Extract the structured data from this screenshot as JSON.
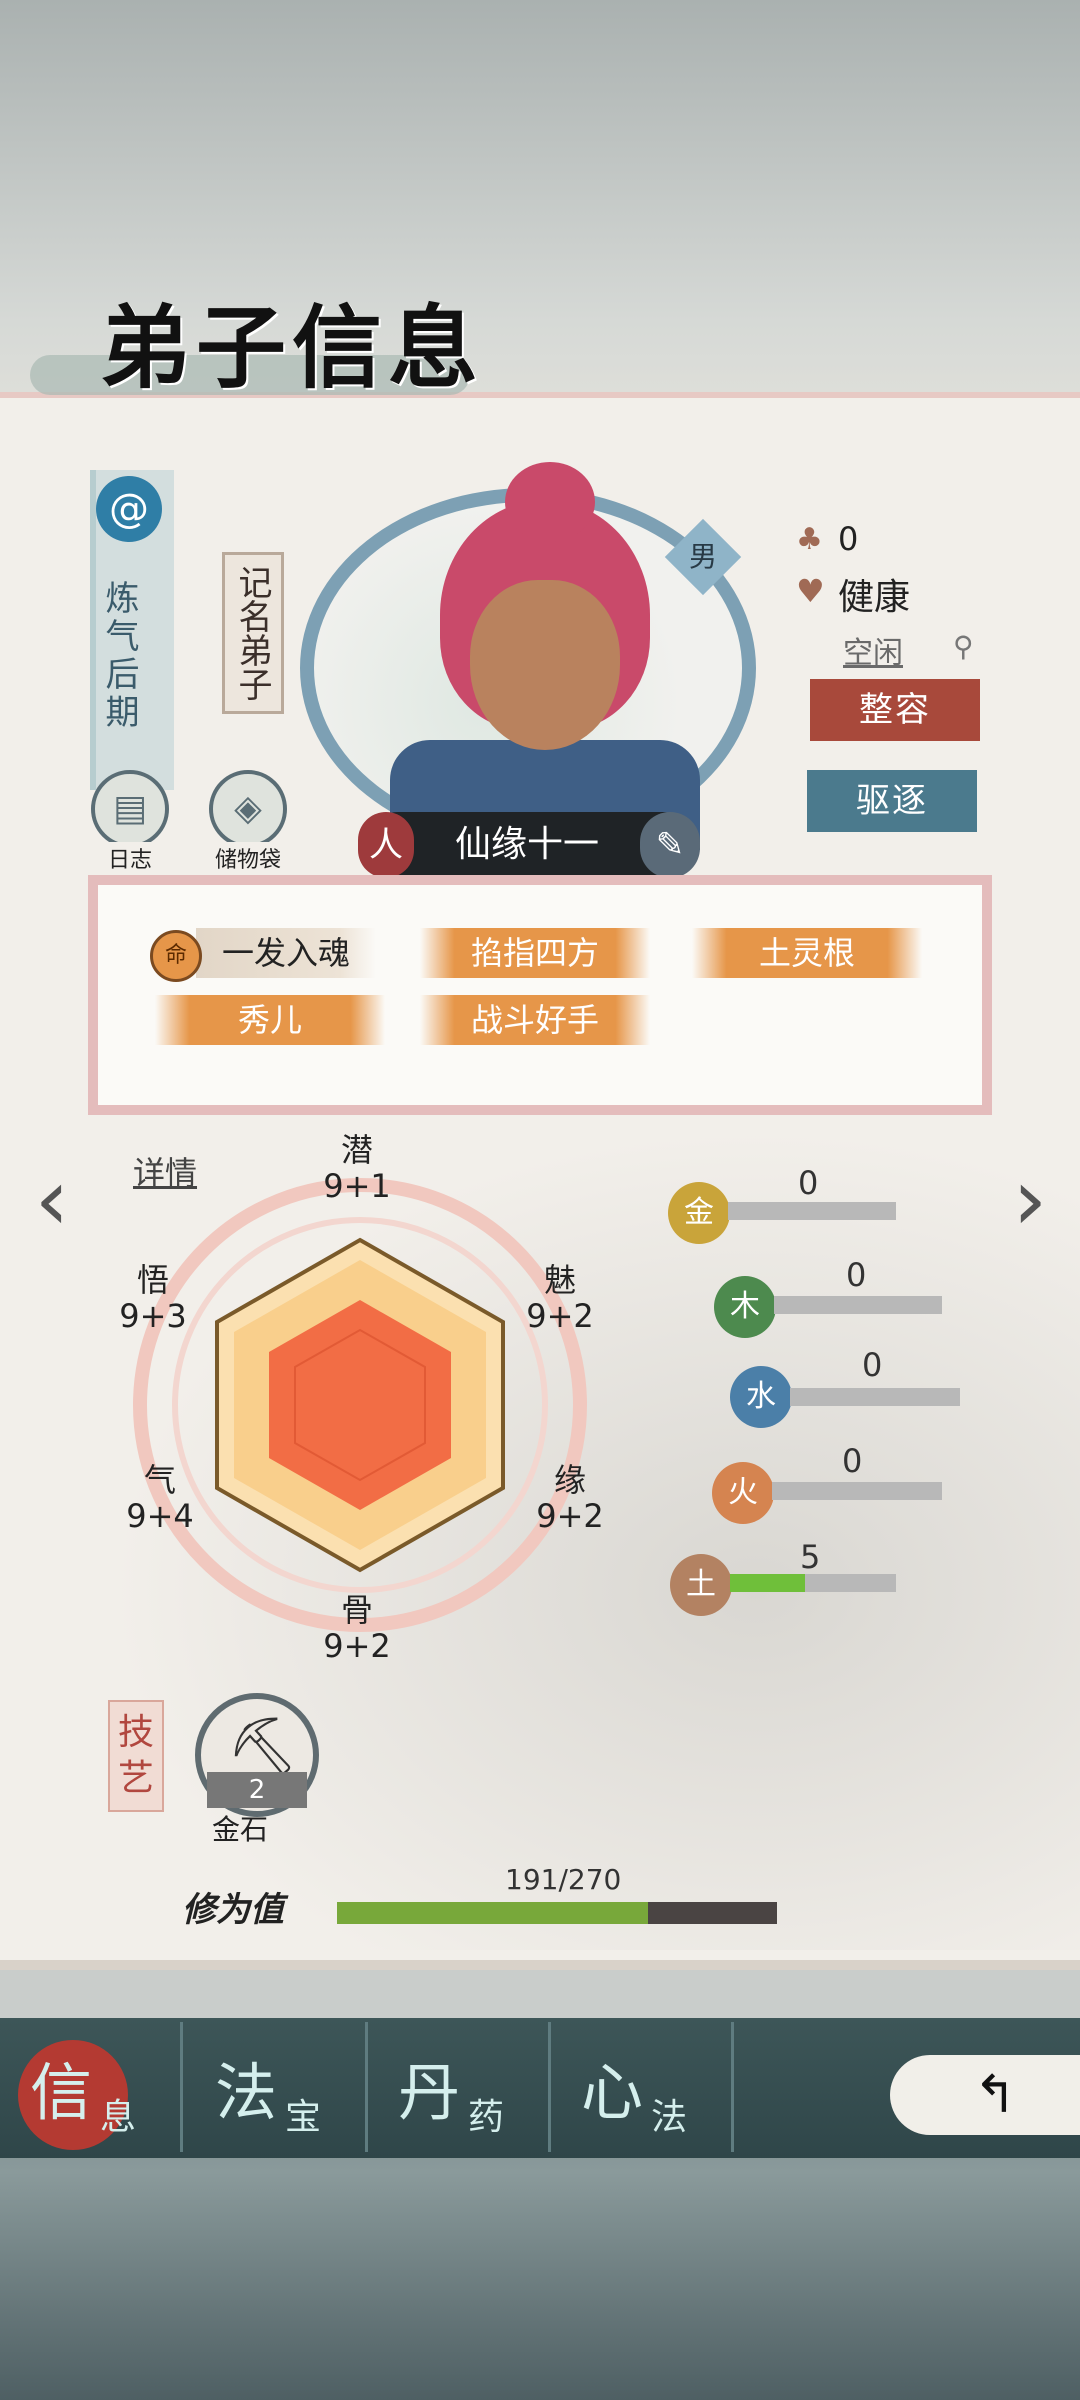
{
  "title": "弟子信息",
  "disciple": {
    "realm": "炼气后期",
    "rank": "记名弟子",
    "gender": "男",
    "name_left_icon": "人",
    "name": "仙缘十一",
    "name_right_icon": "✎",
    "count": "0",
    "health": "健康",
    "activity": "空闲"
  },
  "buttons": {
    "journal": "日志",
    "storage": "储物袋",
    "makeover": "整容",
    "expel": "驱逐"
  },
  "traits": {
    "fate_icon": "命",
    "items": [
      "一发入魂",
      "掐指四方",
      "土灵根",
      "秀儿",
      "战斗好手"
    ]
  },
  "detail_link": "详情",
  "attributes": {
    "potential": {
      "label": "潜",
      "value": "9+1"
    },
    "charm": {
      "label": "魅",
      "value": "9+2"
    },
    "fortune": {
      "label": "缘",
      "value": "9+2"
    },
    "bone": {
      "label": "骨",
      "value": "9+2"
    },
    "qi": {
      "label": "气",
      "value": "9+4"
    },
    "insight": {
      "label": "悟",
      "value": "9+3"
    }
  },
  "elements": [
    {
      "name": "金",
      "value": "0",
      "color": "#c9a43a",
      "fill": 0
    },
    {
      "name": "木",
      "value": "0",
      "color": "#4d8a4e",
      "fill": 0
    },
    {
      "name": "水",
      "value": "0",
      "color": "#4b7fa8",
      "fill": 0
    },
    {
      "name": "火",
      "value": "0",
      "color": "#d58450",
      "fill": 0
    },
    {
      "name": "土",
      "value": "5",
      "color": "#b38262",
      "fill": 0.45
    }
  ],
  "skill": {
    "tag": "技艺",
    "level": "2",
    "name": "金石"
  },
  "cultivation": {
    "label": "修为值",
    "text": "191/270",
    "fraction": 0.707
  },
  "tabs": [
    {
      "big": "信",
      "small": "息"
    },
    {
      "big": "法",
      "small": "宝"
    },
    {
      "big": "丹",
      "small": "药"
    },
    {
      "big": "心",
      "small": "法"
    }
  ],
  "colors": {
    "accent_red": "#a8493b",
    "accent_teal": "#4b7a8d",
    "trait_orange": "#e69649"
  }
}
